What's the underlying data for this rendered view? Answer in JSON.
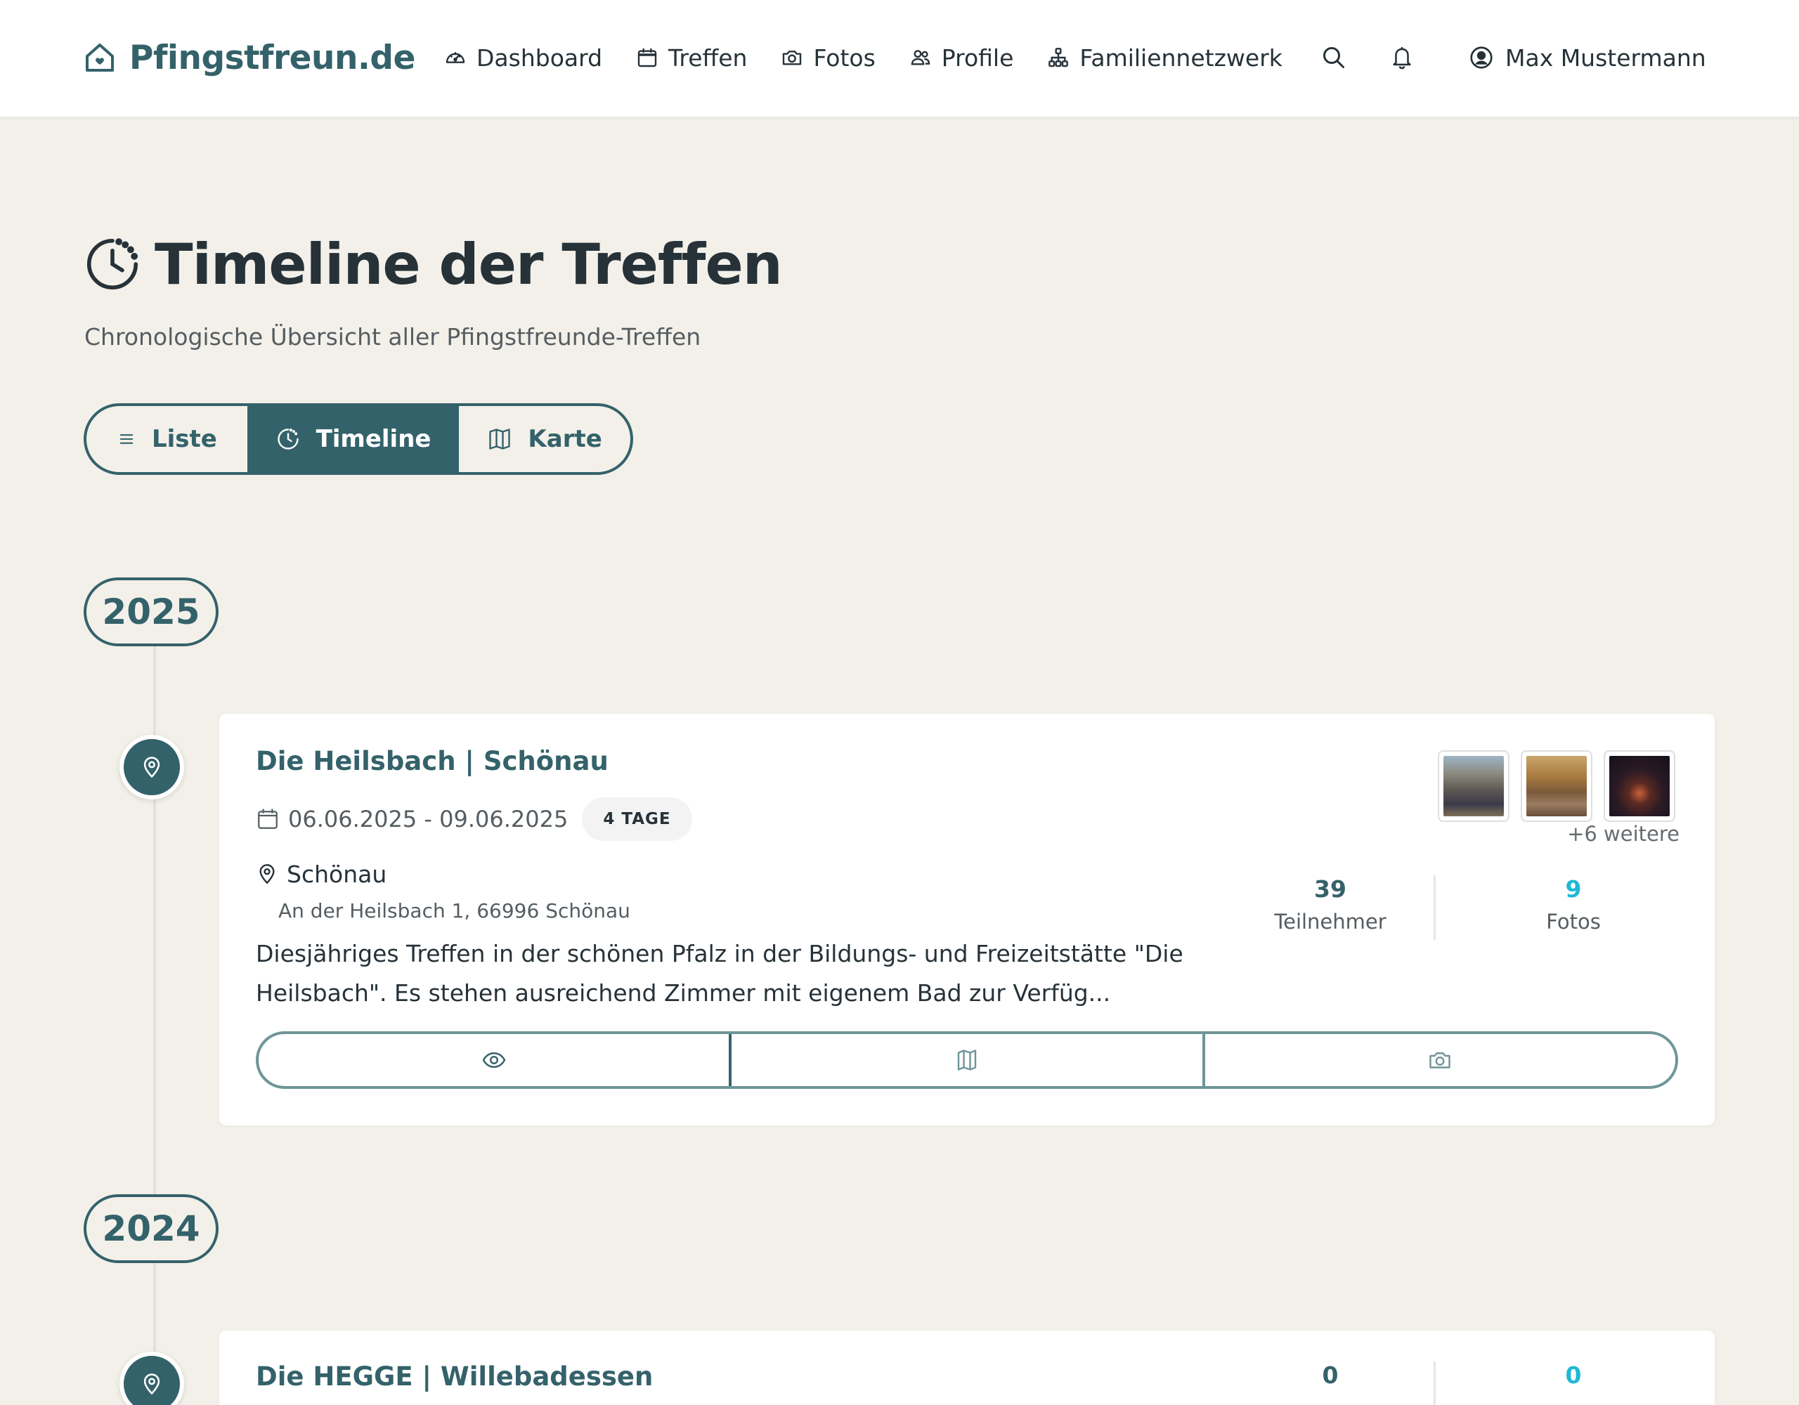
{
  "brand": {
    "name": "Pfingstfreun.de",
    "icon": "house-heart-icon",
    "color": "#34626a"
  },
  "nav": {
    "items": [
      {
        "label": "Dashboard",
        "icon": "speedometer-icon"
      },
      {
        "label": "Treffen",
        "icon": "calendar-icon"
      },
      {
        "label": "Fotos",
        "icon": "camera-icon"
      },
      {
        "label": "Profile",
        "icon": "people-icon"
      },
      {
        "label": "Familiennetzwerk",
        "icon": "diagram-icon"
      }
    ],
    "search_icon": "search-icon",
    "bell_icon": "bell-icon",
    "user": {
      "name": "Max Mustermann",
      "icon": "person-circle-icon"
    }
  },
  "page": {
    "title": "Timeline der Treffen",
    "title_icon": "clock-history-icon",
    "subtitle": "Chronologische Übersicht aller Pfingstfreunde-Treffen"
  },
  "view_switch": {
    "options": [
      {
        "label": "Liste",
        "icon": "list-icon"
      },
      {
        "label": "Timeline",
        "icon": "clock-icon",
        "active": true
      },
      {
        "label": "Karte",
        "icon": "map-icon"
      }
    ]
  },
  "timeline": [
    {
      "year": "2025",
      "event": {
        "title": "Die Heilsbach | Schönau",
        "date": "06.06.2025 - 09.06.2025",
        "duration": "4 TAGE",
        "place": "Schönau",
        "address": "An der Heilsbach 1, 66996 Schönau",
        "description": "Diesjähriges Treffen in der schönen Pfalz in der Bildungs- und Freizeitstätte \"Die Heilsbach\". Es stehen ausreichend Zimmer mit eigenem Bad zur Verfüg...",
        "more_photos": "+6 weitere",
        "participants": {
          "value": "39",
          "label": "Teilnehmer"
        },
        "photos": {
          "value": "9",
          "label": "Fotos"
        }
      }
    },
    {
      "year": "2024",
      "event": {
        "title": "Die HEGGE | Willebadessen",
        "participants": {
          "value": "0"
        },
        "photos": {
          "value": "0"
        }
      }
    }
  ],
  "colors": {
    "primary": "#34626a",
    "background": "#f3f0ea",
    "photo_stat": "#1fb8d6"
  }
}
